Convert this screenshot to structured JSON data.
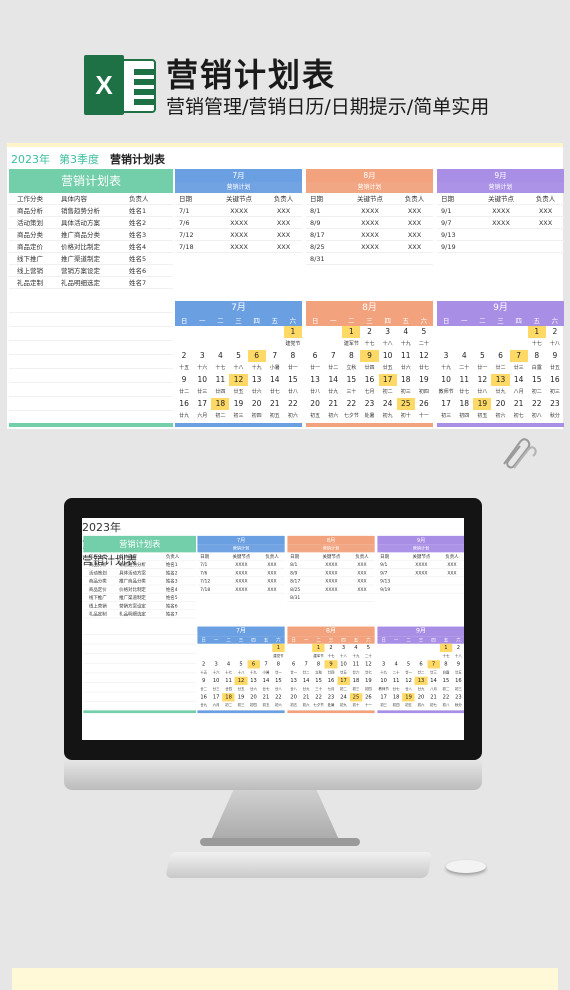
{
  "header": {
    "excel_letter": "X",
    "title": "营销计划表",
    "subtitle": "营销管理/营销日历/日期提示/简单实用"
  },
  "sheet": {
    "year": "2023年",
    "quarter": "第3季度",
    "title": "营销计划表",
    "left": {
      "heading": "营销计划表",
      "columns": [
        "工作分类",
        "具体内容",
        "负责人"
      ],
      "rows": [
        [
          "商品分析",
          "销售趋势分析",
          "姓名1"
        ],
        [
          "活动策划",
          "具体活动方案",
          "姓名2"
        ],
        [
          "商品分类",
          "推广商品分类",
          "姓名3"
        ],
        [
          "商品定价",
          "价格对比制定",
          "姓名4"
        ],
        [
          "线下推广",
          "推广渠道制定",
          "姓名5"
        ],
        [
          "线上营销",
          "营销方案设定",
          "姓名6"
        ],
        [
          "礼品定制",
          "礼品明细选定",
          "姓名7"
        ]
      ]
    },
    "months": [
      {
        "name": "7月",
        "sub": "营销计划",
        "color": "#6a9fe2",
        "columns": [
          "日期",
          "关键节点",
          "负责人"
        ],
        "rows": [
          [
            "7/1",
            "XXXX",
            "XXX"
          ],
          [
            "7/6",
            "XXXX",
            "XXX"
          ],
          [
            "7/12",
            "XXXX",
            "XXX"
          ],
          [
            "7/18",
            "XXXX",
            "XXX"
          ]
        ],
        "calendar": {
          "title": "7月",
          "weekdays": [
            "日",
            "一",
            "二",
            "三",
            "四",
            "五",
            "六"
          ],
          "weeks": [
            {
              "days": [
                "",
                "",
                "",
                "",
                "",
                "",
                "1"
              ],
              "lunar": [
                "",
                "",
                "",
                "",
                "",
                "",
                "建党节"
              ],
              "hl": [
                6
              ]
            },
            {
              "days": [
                "2",
                "3",
                "4",
                "5",
                "6",
                "7",
                "8"
              ],
              "lunar": [
                "十五",
                "十六",
                "十七",
                "十八",
                "十九",
                "小暑",
                "廿一"
              ],
              "hl": [
                4
              ]
            },
            {
              "days": [
                "9",
                "10",
                "11",
                "12",
                "13",
                "14",
                "15"
              ],
              "lunar": [
                "廿二",
                "廿三",
                "廿四",
                "廿五",
                "廿六",
                "廿七",
                "廿八"
              ],
              "hl": [
                3
              ]
            },
            {
              "days": [
                "16",
                "17",
                "18",
                "19",
                "20",
                "21",
                "22"
              ],
              "lunar": [
                "廿九",
                "六月",
                "初二",
                "初三",
                "初四",
                "初五",
                "初六"
              ],
              "hl": [
                2
              ]
            }
          ]
        }
      },
      {
        "name": "8月",
        "sub": "营销计划",
        "color": "#f2a37e",
        "columns": [
          "日期",
          "关键节点",
          "负责人"
        ],
        "rows": [
          [
            "8/1",
            "XXXX",
            "XXX"
          ],
          [
            "8/9",
            "XXXX",
            "XXX"
          ],
          [
            "8/17",
            "XXXX",
            "XXX"
          ],
          [
            "8/25",
            "XXXX",
            "XXX"
          ],
          [
            "8/31",
            "",
            ""
          ]
        ],
        "calendar": {
          "title": "8月",
          "weekdays": [
            "日",
            "一",
            "二",
            "三",
            "四",
            "五",
            "六"
          ],
          "weeks": [
            {
              "days": [
                "",
                "",
                "1",
                "2",
                "3",
                "4",
                "5"
              ],
              "lunar": [
                "",
                "",
                "建军节",
                "十七",
                "十八",
                "十九",
                "二十"
              ],
              "hl": [
                2
              ]
            },
            {
              "days": [
                "6",
                "7",
                "8",
                "9",
                "10",
                "11",
                "12"
              ],
              "lunar": [
                "廿一",
                "廿二",
                "立秋",
                "廿四",
                "廿五",
                "廿六",
                "廿七"
              ],
              "hl": [
                3
              ]
            },
            {
              "days": [
                "13",
                "14",
                "15",
                "16",
                "17",
                "18",
                "19"
              ],
              "lunar": [
                "廿八",
                "廿九",
                "三十",
                "七月",
                "初二",
                "初三",
                "初四"
              ],
              "hl": [
                4
              ]
            },
            {
              "days": [
                "20",
                "21",
                "22",
                "23",
                "24",
                "25",
                "26"
              ],
              "lunar": [
                "初五",
                "初六",
                "七夕节",
                "处暑",
                "初九",
                "初十",
                "十一"
              ],
              "hl": [
                5
              ]
            }
          ]
        }
      },
      {
        "name": "9月",
        "sub": "营销计划",
        "color": "#a98ee6",
        "columns": [
          "日期",
          "关键节点",
          "负责人"
        ],
        "rows": [
          [
            "9/1",
            "XXXX",
            "XXX"
          ],
          [
            "9/7",
            "XXXX",
            "XXX"
          ],
          [
            "9/13",
            "",
            ""
          ],
          [
            "9/19",
            "",
            ""
          ]
        ],
        "calendar": {
          "title": "9月",
          "weekdays": [
            "日",
            "一",
            "二",
            "三",
            "四",
            "五",
            "六"
          ],
          "weeks": [
            {
              "days": [
                "",
                "",
                "",
                "",
                "",
                "1",
                "2"
              ],
              "lunar": [
                "",
                "",
                "",
                "",
                "",
                "十七",
                "十八"
              ],
              "hl": [
                5
              ]
            },
            {
              "days": [
                "3",
                "4",
                "5",
                "6",
                "7",
                "8",
                "9"
              ],
              "lunar": [
                "十九",
                "二十",
                "廿一",
                "廿二",
                "廿三",
                "白露",
                "廿五"
              ],
              "hl": [
                4
              ]
            },
            {
              "days": [
                "10",
                "11",
                "12",
                "13",
                "14",
                "15",
                "16"
              ],
              "lunar": [
                "教师节",
                "廿七",
                "廿八",
                "廿九",
                "八月",
                "初二",
                "初三"
              ],
              "hl": [
                3
              ]
            },
            {
              "days": [
                "17",
                "18",
                "19",
                "20",
                "21",
                "22",
                "23"
              ],
              "lunar": [
                "初三",
                "初四",
                "初五",
                "初六",
                "初七",
                "初八",
                "秋分"
              ],
              "hl": [
                2
              ]
            }
          ]
        }
      }
    ]
  },
  "colors": {
    "accent_green": "#72cfa9",
    "highlight": "#ffd966",
    "quarter_text": "#3dbf9f"
  }
}
